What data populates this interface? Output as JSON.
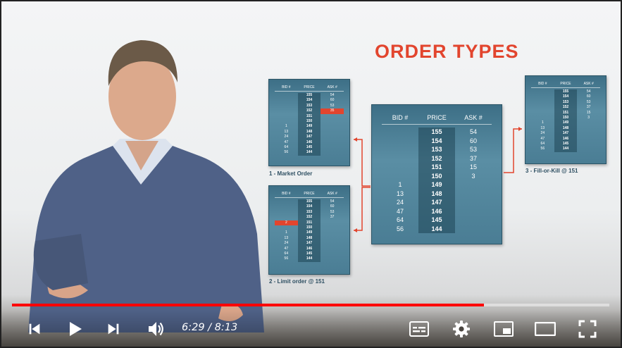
{
  "slide": {
    "title": "ORDER TYPES",
    "columns": {
      "bid": "BID #",
      "price": "PRICE",
      "ask": "ASK #"
    },
    "central_book": {
      "rows": [
        {
          "bid": "",
          "price": "155",
          "ask": "54"
        },
        {
          "bid": "",
          "price": "154",
          "ask": "60"
        },
        {
          "bid": "",
          "price": "153",
          "ask": "53"
        },
        {
          "bid": "",
          "price": "152",
          "ask": "37"
        },
        {
          "bid": "",
          "price": "151",
          "ask": "15"
        },
        {
          "bid": "",
          "price": "150",
          "ask": "3"
        },
        {
          "bid": "1",
          "price": "149",
          "ask": ""
        },
        {
          "bid": "13",
          "price": "148",
          "ask": ""
        },
        {
          "bid": "24",
          "price": "147",
          "ask": ""
        },
        {
          "bid": "47",
          "price": "146",
          "ask": ""
        },
        {
          "bid": "64",
          "price": "145",
          "ask": ""
        },
        {
          "bid": "56",
          "price": "144",
          "ask": ""
        }
      ]
    },
    "market_order": {
      "caption": "1 - Market Order",
      "rows": [
        {
          "bid": "",
          "price": "155",
          "ask": "54"
        },
        {
          "bid": "",
          "price": "154",
          "ask": "60"
        },
        {
          "bid": "",
          "price": "153",
          "ask": "53"
        },
        {
          "bid": "",
          "price": "152",
          "ask": "35",
          "highlight": "ask"
        },
        {
          "bid": "",
          "price": "151",
          "ask": ""
        },
        {
          "bid": "",
          "price": "150",
          "ask": ""
        },
        {
          "bid": "1",
          "price": "149",
          "ask": ""
        },
        {
          "bid": "13",
          "price": "148",
          "ask": ""
        },
        {
          "bid": "24",
          "price": "147",
          "ask": ""
        },
        {
          "bid": "47",
          "price": "146",
          "ask": ""
        },
        {
          "bid": "64",
          "price": "145",
          "ask": ""
        },
        {
          "bid": "56",
          "price": "144",
          "ask": ""
        }
      ]
    },
    "limit_order": {
      "caption": "2 - Limit order @ 151",
      "rows": [
        {
          "bid": "",
          "price": "155",
          "ask": "54"
        },
        {
          "bid": "",
          "price": "154",
          "ask": "60"
        },
        {
          "bid": "",
          "price": "153",
          "ask": "53"
        },
        {
          "bid": "",
          "price": "152",
          "ask": "37"
        },
        {
          "bid": "2",
          "price": "151",
          "ask": "",
          "highlight": "bid"
        },
        {
          "bid": "",
          "price": "150",
          "ask": ""
        },
        {
          "bid": "1",
          "price": "149",
          "ask": ""
        },
        {
          "bid": "13",
          "price": "148",
          "ask": ""
        },
        {
          "bid": "24",
          "price": "147",
          "ask": ""
        },
        {
          "bid": "47",
          "price": "146",
          "ask": ""
        },
        {
          "bid": "64",
          "price": "145",
          "ask": ""
        },
        {
          "bid": "56",
          "price": "144",
          "ask": ""
        }
      ]
    },
    "fill_or_kill": {
      "caption": "3 - Fill-or-Kill @ 151",
      "rows": [
        {
          "bid": "",
          "price": "155",
          "ask": "54"
        },
        {
          "bid": "",
          "price": "154",
          "ask": "60"
        },
        {
          "bid": "",
          "price": "153",
          "ask": "53"
        },
        {
          "bid": "",
          "price": "152",
          "ask": "37"
        },
        {
          "bid": "",
          "price": "151",
          "ask": "15"
        },
        {
          "bid": "",
          "price": "150",
          "ask": "3"
        },
        {
          "bid": "1",
          "price": "149",
          "ask": ""
        },
        {
          "bid": "13",
          "price": "148",
          "ask": ""
        },
        {
          "bid": "24",
          "price": "147",
          "ask": ""
        },
        {
          "bid": "47",
          "price": "146",
          "ask": ""
        },
        {
          "bid": "64",
          "price": "145",
          "ask": ""
        },
        {
          "bid": "56",
          "price": "144",
          "ask": ""
        }
      ]
    }
  },
  "player": {
    "progress": 0.79,
    "time": "6:29 / 8:13",
    "icons": {
      "previous": "skip-previous-icon",
      "play": "play-icon",
      "next": "skip-next-icon",
      "volume": "volume-icon",
      "subtitles": "subtitles-icon",
      "settings": "gear-icon",
      "miniplayer": "miniplayer-icon",
      "theater": "theater-mode-icon",
      "fullscreen": "fullscreen-icon"
    }
  },
  "colors": {
    "title": "#e2452e",
    "progress": "#ff0000",
    "book": "#4a7d94"
  }
}
